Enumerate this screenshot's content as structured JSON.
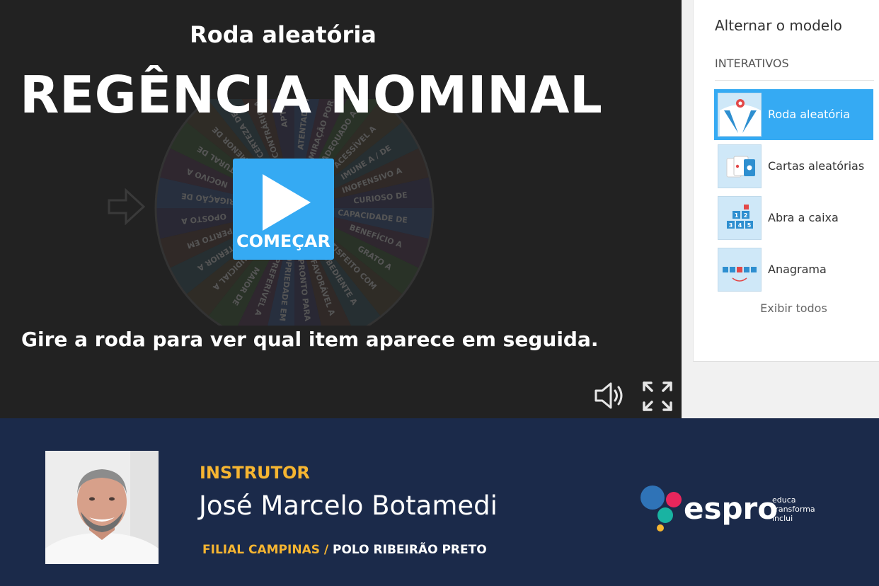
{
  "stage": {
    "template": "Roda aleatória",
    "title": "REGÊNCIA NOMINAL",
    "start_label": "COMEÇAR",
    "instructions": "Gire a roda para ver qual item aparece em seguida.",
    "wheel_items": [
      "ATENTADO A",
      "ADMIRAÇÃO POR",
      "ADEQUADO A",
      "ACESSÍVEL A",
      "IMUNE A / DE",
      "INOFENSIVO A",
      "CURIOSO DE",
      "CAPACIDADE DE",
      "BENEFÍCIO A",
      "GRATO A",
      "SATISFEITO COM",
      "OBEDIENTE A",
      "FAVORÁVEL A",
      "PRONTO PARA",
      "PROPRIEDADE EM",
      "PREFERÍVEL A",
      "MAIOR DE",
      "PREJUDICIAL A",
      "POSTERIOR A",
      "PERITO EM",
      "OPOSTO A",
      "OBRIGAÇÃO DE",
      "NOCIVO A",
      "NATURAL DE",
      "MENOR DE",
      "CERTEZA DE",
      "CONTRÁRIO A",
      "APTO A"
    ]
  },
  "sidebar": {
    "switch_label": "Alternar o modelo",
    "section_label": "INTERATIVOS",
    "items": [
      {
        "label": "Roda aleatória",
        "icon": "wheel-icon",
        "active": true
      },
      {
        "label": "Cartas aleatórias",
        "icon": "cards-icon",
        "active": false
      },
      {
        "label": "Abra a caixa",
        "icon": "boxes-icon",
        "active": false
      },
      {
        "label": "Anagrama",
        "icon": "anagram-icon",
        "active": false
      }
    ],
    "show_all": "Exibir todos"
  },
  "footer": {
    "role": "INSTRUTOR",
    "name": "José Marcelo Botamedi",
    "location_primary": "FILIAL CAMPINAS /",
    "location_secondary": "POLO RIBEIRÃO PRETO",
    "logo_text": "espro",
    "logo_tagline": [
      "educa",
      "transforma",
      "inclui"
    ]
  },
  "colors": {
    "accent": "#35aaf3",
    "footer_bg": "#1b2a4a",
    "footer_highlight": "#f6b531",
    "stage_bg": "#222222"
  }
}
